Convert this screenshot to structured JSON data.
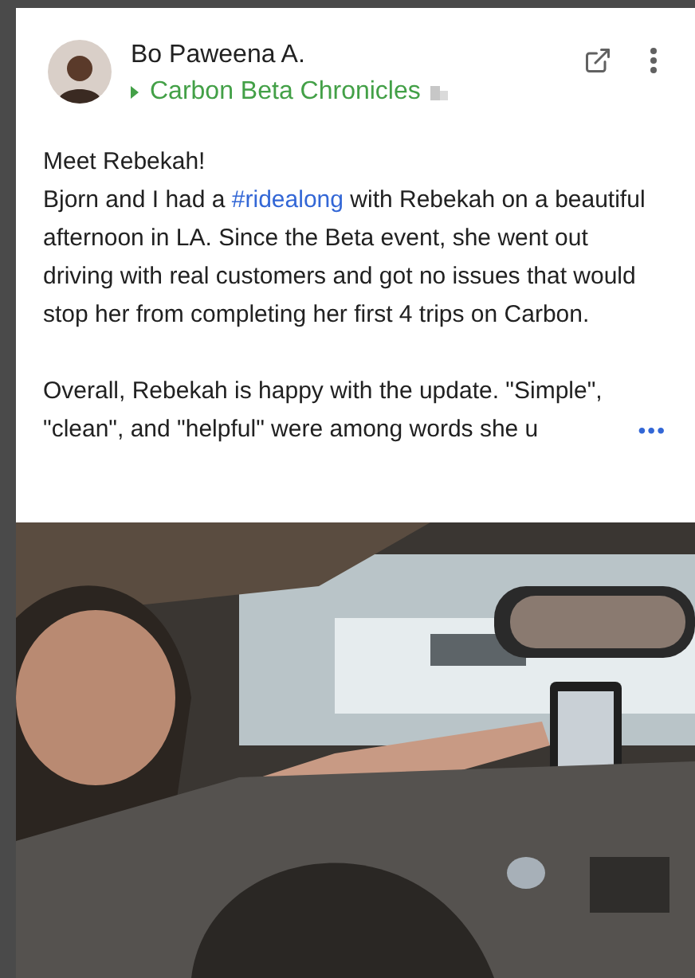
{
  "post": {
    "author": "Bo Paweena A.",
    "community": "Carbon Beta Chronicles",
    "greeting": "Meet Rebekah!",
    "paragraphs": [
      {
        "before": "Bjorn and I had a ",
        "hashtag": "#ridealong",
        "after": " with Rebekah on a beautiful afternoon in LA. Since  the Beta event, she went out driving with real customers and got no issues that would stop her from completing her first 4 trips on Carbon."
      },
      {
        "before": "Overall, Rebekah is happy with the update. \"Simple\", \"clean\", and \"helpful\" were among words she u"
      }
    ],
    "more": "•••"
  }
}
